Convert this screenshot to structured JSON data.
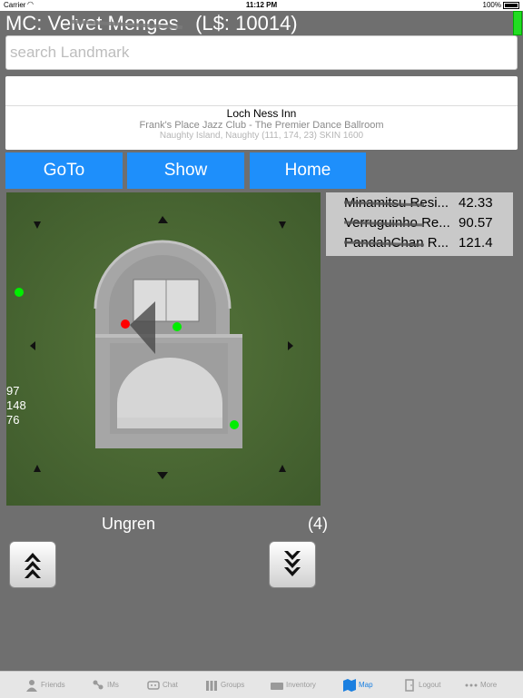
{
  "status_bar": {
    "carrier": "Carrier",
    "time": "11:12 PM",
    "battery": "100%"
  },
  "header": {
    "prefix": "MC: Ve",
    "name_scribbled": "lvet Menges",
    "balance": "(L$: 10014)"
  },
  "search": {
    "placeholder": "search Landmark",
    "value": ""
  },
  "landmarks_picker": {
    "selected": "Loch Ness Inn",
    "next": "Frank's Place Jazz Club - The Premier Dance Ballroom",
    "next2": "Naughty Island, Naughty (111, 174, 23) SKIN 1600"
  },
  "buttons": {
    "goto": "GoTo",
    "show": "Show",
    "home": "Home"
  },
  "map": {
    "coordinates": [
      "97",
      "148",
      "76"
    ],
    "avatar_dot_color": "#ff0000",
    "others_dot_color": "#00ee00"
  },
  "nearby": [
    {
      "name": "Minamitsu Resi...",
      "distance": "42.33"
    },
    {
      "name": "Verruguinho Re...",
      "distance": "90.57"
    },
    {
      "name": "PandahChan R...",
      "distance": "121.4"
    }
  ],
  "region": {
    "name": "Ungren",
    "count": "(4)"
  },
  "tabbar": {
    "tabs": [
      {
        "label": "Friends",
        "icon": "friends-icon"
      },
      {
        "label": "IMs",
        "icon": "ims-icon"
      },
      {
        "label": "Chat",
        "icon": "chat-icon"
      },
      {
        "label": "Groups",
        "icon": "groups-icon"
      },
      {
        "label": "Inventory",
        "icon": "inventory-icon"
      },
      {
        "label": "Map",
        "icon": "map-icon"
      },
      {
        "label": "Logout",
        "icon": "logout-icon"
      },
      {
        "label": "More",
        "icon": "more-icon"
      }
    ],
    "active_tab": "Map",
    "active_color": "#1a7fe0"
  }
}
